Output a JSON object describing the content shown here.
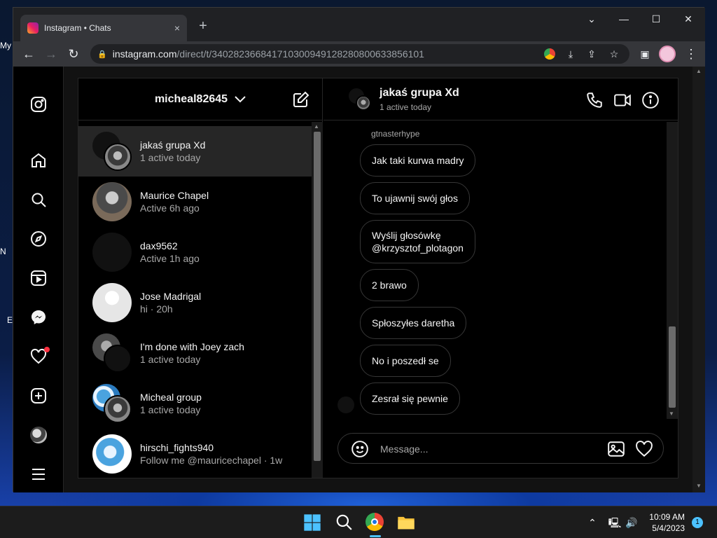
{
  "desktop": {
    "labels": [
      "My",
      "N",
      "E"
    ]
  },
  "browser": {
    "tab_title": "Instagram • Chats",
    "tab_close": "×",
    "new_tab": "+",
    "url_host": "instagram.com",
    "url_path": "/direct/t/340282366841710300949128280800633856101",
    "window_controls": {
      "dropdown": "⌄",
      "minimize": "—",
      "maximize": "☐",
      "close": "✕"
    }
  },
  "instagram": {
    "account_username": "micheal82645",
    "threads": [
      {
        "name": "jakaś grupa Xd",
        "subtitle": "1 active today",
        "group": true,
        "active": true
      },
      {
        "name": "Maurice Chapel",
        "subtitle": "Active 6h ago",
        "group": false,
        "active": false
      },
      {
        "name": "dax9562",
        "subtitle": "Active 1h ago",
        "group": false,
        "active": false
      },
      {
        "name": "Jose Madrigal",
        "subtitle": "hi · 20h",
        "group": false,
        "active": false
      },
      {
        "name": "I'm done with Joey zach",
        "subtitle": "1 active today",
        "group": true,
        "active": false
      },
      {
        "name": "Micheal group",
        "subtitle": "1 active today",
        "group": true,
        "active": false
      },
      {
        "name": "hirschi_fights940",
        "subtitle": "Follow me @mauricechapel · 1w",
        "group": false,
        "active": false
      }
    ],
    "chat": {
      "title": "jakaś grupa Xd",
      "status": "1 active today",
      "sender": "gtnasterhype",
      "messages": [
        "Jak taki kurwa madry",
        "To ujawnij swój głos",
        "Wyślij głosówkę\n@krzysztof_plotagon",
        "2 brawo",
        "Spłoszyłes daretha",
        "No i poszedł se",
        "Zesrał się pewnie"
      ],
      "composer_placeholder": "Message..."
    }
  },
  "taskbar": {
    "time": "10:09 AM",
    "date": "5/4/2023",
    "notification_count": "1"
  },
  "colors": {
    "accent_notification": "#ff3040",
    "background": "#000000",
    "bubble_border": "#363636"
  }
}
